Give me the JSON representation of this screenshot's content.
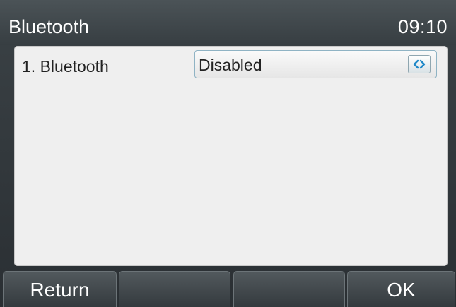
{
  "header": {
    "title": "Bluetooth",
    "time": "09:10"
  },
  "settings": [
    {
      "label": "1. Bluetooth",
      "value": "Disabled",
      "toggle_icon": "left-right-arrows-icon"
    }
  ],
  "softkeys": [
    {
      "label": "Return"
    },
    {
      "label": ""
    },
    {
      "label": ""
    },
    {
      "label": "OK"
    }
  ],
  "colors": {
    "accent": "#1f88c8",
    "content_bg": "#efefef",
    "bar_bg": "#3b4246"
  }
}
